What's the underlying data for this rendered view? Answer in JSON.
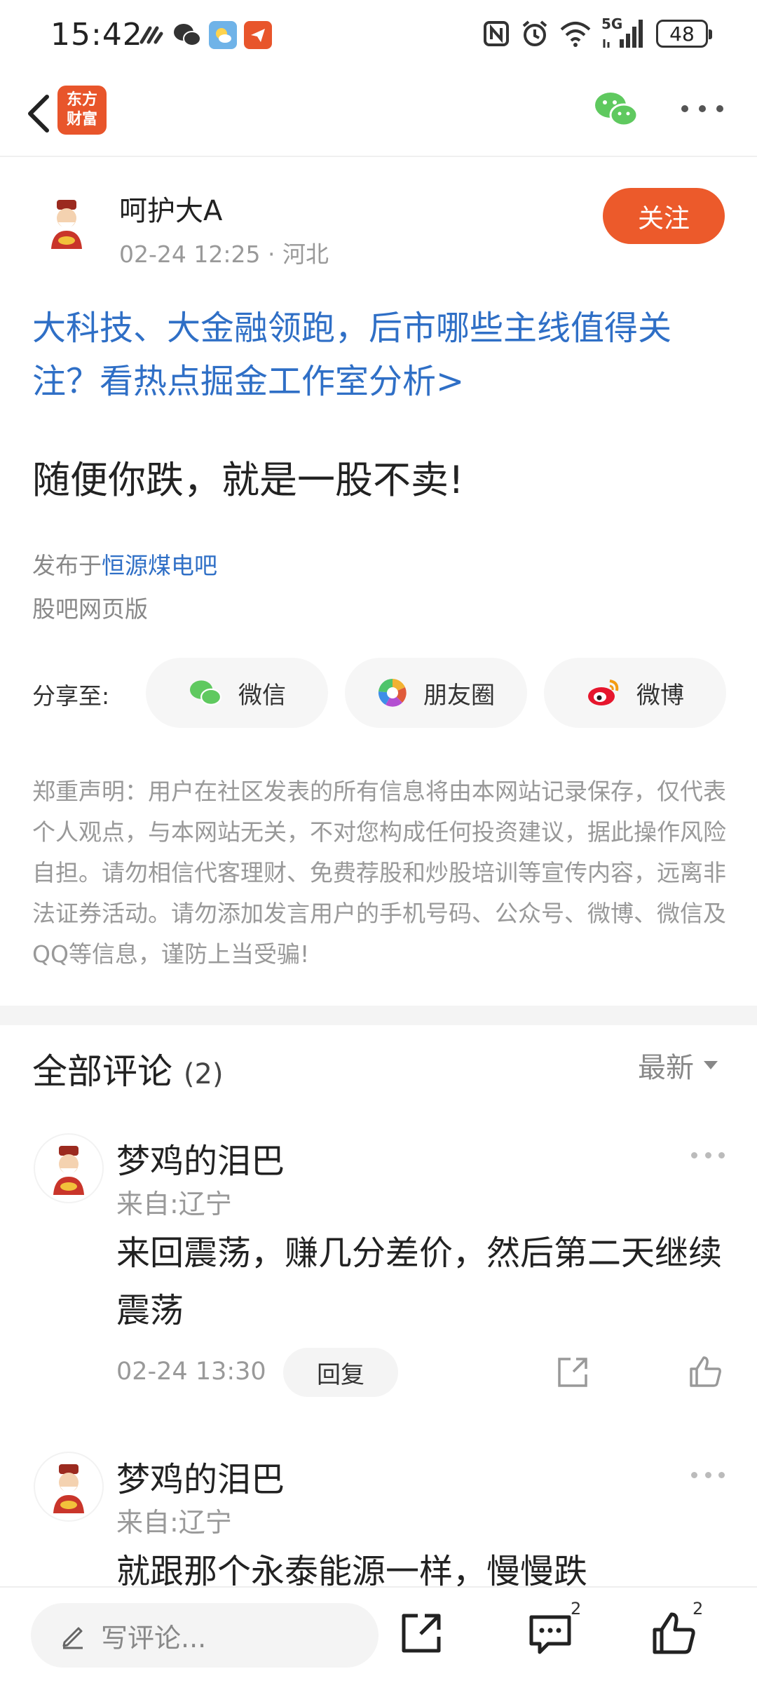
{
  "status_bar": {
    "time": "15:42",
    "battery": "48",
    "network": "5G"
  },
  "nav": {
    "logo_line1": "东方",
    "logo_line2": "财富"
  },
  "post": {
    "author": "呵护大A",
    "meta": "02-24 12:25 · 河北",
    "follow_label": "关注",
    "headline": "大科技、大金融领跑，后市哪些主线值得关注？看热点掘金工作室分析>",
    "body": "随便你跌，就是一股不卖!",
    "posted_in_prefix": "发布于",
    "forum": "恒源煤电吧",
    "source": "股吧网页版"
  },
  "share": {
    "label": "分享至:",
    "wechat": "微信",
    "moments": "朋友圈",
    "weibo": "微博"
  },
  "disclaimer": "郑重声明：用户在社区发表的所有信息将由本网站记录保存，仅代表个人观点，与本网站无关，不对您构成任何投资建议，据此操作风险自担。请勿相信代客理财、免费荐股和炒股培训等宣传内容，远离非法证券活动。请勿添加发言用户的手机号码、公众号、微博、微信及QQ等信息，谨防上当受骗!",
  "comments_section": {
    "title": "全部评论",
    "count": "(2)",
    "sort": "最新"
  },
  "comments": [
    {
      "name": "梦鸡的泪巴",
      "from": "来自:辽宁",
      "text": "来回震荡，赚几分差价，然后第二天继续震荡",
      "time": "02-24 13:30",
      "reply": "回复"
    },
    {
      "name": "梦鸡的泪巴",
      "from": "来自:辽宁",
      "text": "就跟那个永泰能源一样，慢慢跌"
    }
  ],
  "bottom_bar": {
    "placeholder": "写评论...",
    "comment_badge": "2",
    "like_badge": "2"
  },
  "colors": {
    "accent": "#ec5a2b",
    "link": "#2f6fc6",
    "logo": "#e8552b"
  }
}
